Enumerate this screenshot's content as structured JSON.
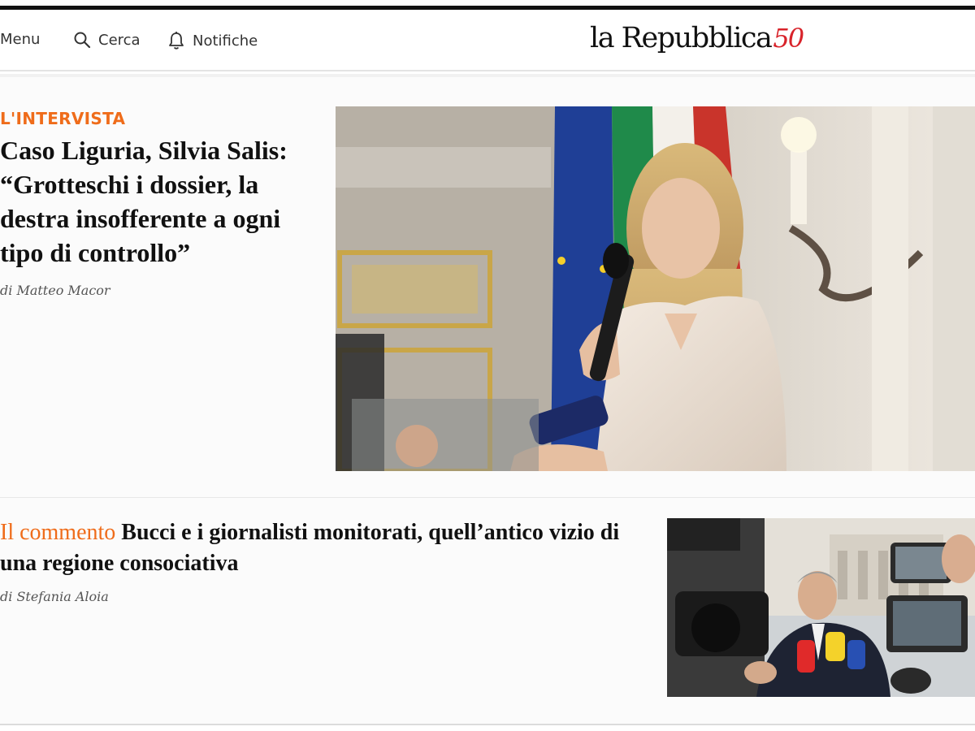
{
  "header": {
    "menu_label": "Menu",
    "search_label": "Cerca",
    "notifications_label": "Notifiche",
    "logo_text": "la Repubblica",
    "logo_mark": "50"
  },
  "lead": {
    "kicker": "L'INTERVISTA",
    "title": "Caso Liguria, Silvia Salis: “Grotteschi i dossier, la destra insofferente a ogni tipo di controllo”",
    "byline": "di Matteo Macor"
  },
  "second": {
    "kicker": "Il commento",
    "title": "Bucci e i giornalisti monitorati, quell’antico vizio di una regione consociativa",
    "byline": "di Stefania Aloia"
  },
  "colors": {
    "accent": "#ef6c1a",
    "brand_red": "#d8232a"
  },
  "icons": [
    "hamburger-icon",
    "search-icon",
    "bell-icon"
  ]
}
